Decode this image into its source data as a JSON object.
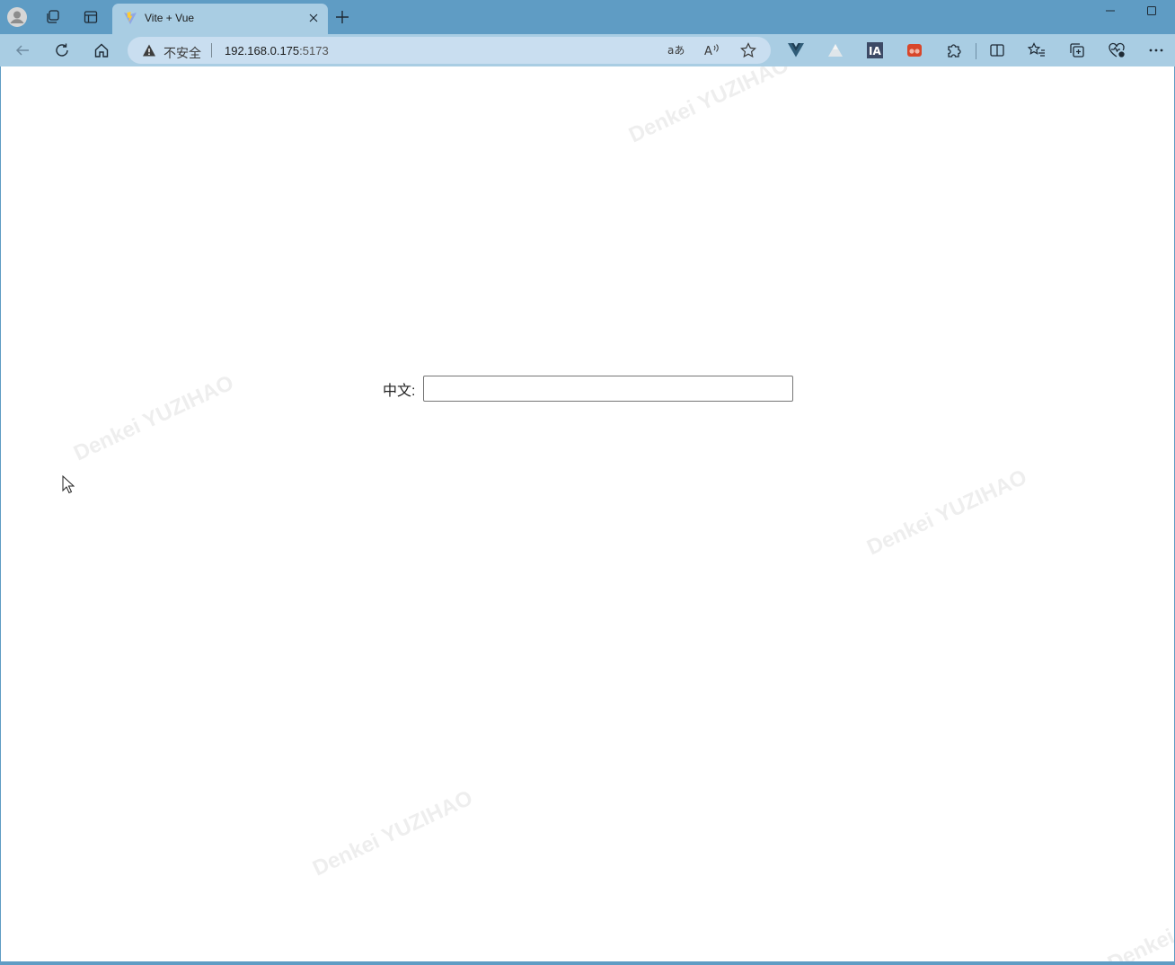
{
  "browser": {
    "tab": {
      "title": "Vite + Vue"
    },
    "address_bar": {
      "security_label": "不安全",
      "url_host": "192.168.0.175",
      "url_port": ":5173"
    }
  },
  "page": {
    "form": {
      "label": "中文:",
      "input_value": ""
    },
    "watermark_text": "Denkei YUZIHAO",
    "watermark_partial": "Denkei"
  },
  "colors": {
    "tabstrip_bg": "#5f9cc4",
    "toolbar_bg": "#a9cde3",
    "page_bg": "#ffffff"
  }
}
